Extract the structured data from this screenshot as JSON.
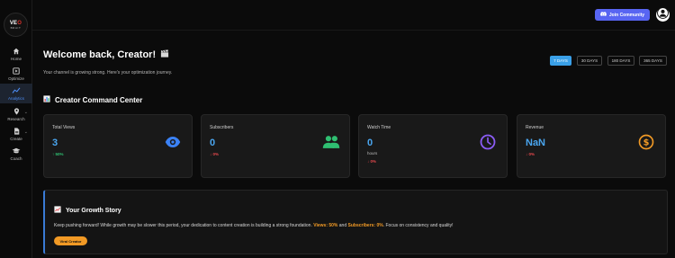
{
  "brand": {
    "logo_line1": "VE",
    "logo_line1_accent": "O",
    "logo_line2": "BRAIT"
  },
  "sidebar": {
    "items": [
      {
        "label": "Home",
        "icon": "home-icon"
      },
      {
        "label": "Optimize",
        "icon": "optimize-icon"
      },
      {
        "label": "Analytics",
        "icon": "analytics-icon",
        "active": true
      },
      {
        "label": "Research",
        "icon": "research-icon"
      },
      {
        "label": "Create",
        "icon": "create-icon"
      },
      {
        "label": "Coach",
        "icon": "coach-icon"
      }
    ]
  },
  "header": {
    "join_label": "Join Community"
  },
  "main": {
    "title": "Welcome back, Creator!",
    "subtitle": "Your channel is growing strong. Here's your optimization journey.",
    "ranges": [
      "7 DAYS",
      "30 DAYS",
      "180 DAYS",
      "365 DAYS"
    ],
    "active_range": "7 DAYS",
    "section_title": "Creator Command Center",
    "cards": [
      {
        "label": "Total Views",
        "value": "3",
        "change": "↑ 50%",
        "trend": "up",
        "icon": "eye-icon",
        "icon_color": "#3b82f6"
      },
      {
        "label": "Subscribers",
        "value": "0",
        "change": "↓ 0%",
        "trend": "down",
        "icon": "people-icon",
        "icon_color": "#2fbf71"
      },
      {
        "label": "Watch Time",
        "value": "0",
        "sub": "hours",
        "change": "↓ 0%",
        "trend": "down",
        "icon": "clock-icon",
        "icon_color": "#8b5cf6"
      },
      {
        "label": "Revenue",
        "value": "NaN",
        "change": "↓ 0%",
        "trend": "down",
        "icon": "dollar-icon",
        "icon_color": "#f29a25"
      }
    ],
    "story": {
      "title": "Your Growth Story",
      "text_before": "Keep pushing forward! While growth may be slower this period, your dedication to content creation is building a strong foundation.",
      "views_text": "Views: 50%",
      "and_text": "and",
      "subs_text": "Subscribers: 0%",
      "text_after": ". Focus on consistency and quality!",
      "badge": "Viral Creator"
    }
  },
  "colors": {
    "accent": "#3aa0e8",
    "discord": "#5865f2",
    "orange": "#f29a25"
  }
}
